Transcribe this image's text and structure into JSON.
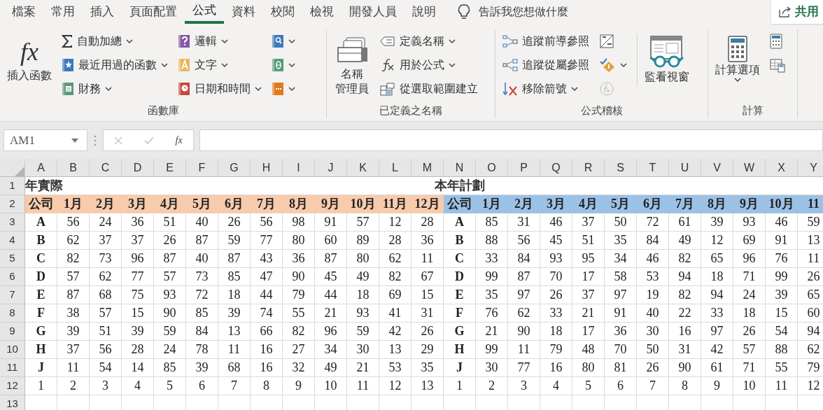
{
  "ribbon_tabs": [
    {
      "label": "檔案",
      "selected": false
    },
    {
      "label": "常用",
      "selected": false
    },
    {
      "label": "插入",
      "selected": false
    },
    {
      "label": "頁面配置",
      "selected": false
    },
    {
      "label": "公式",
      "selected": true
    },
    {
      "label": "資料",
      "selected": false
    },
    {
      "label": "校閱",
      "selected": false
    },
    {
      "label": "檢視",
      "selected": false
    },
    {
      "label": "開發人員",
      "selected": false
    },
    {
      "label": "說明",
      "selected": false
    }
  ],
  "tell_me": "告訴我您想做什麼",
  "share_button": "共用",
  "ribbon_groups": [
    {
      "label": "函數庫",
      "columns": [
        {
          "kind": "large",
          "label": "插入函數",
          "glyph": "fx",
          "dropdown": false
        },
        {
          "kind": "stack",
          "commands": [
            {
              "label": "自動加總",
              "dropdown": true,
              "disabled": false
            },
            {
              "label": "最近用過的函數",
              "dropdown": true,
              "disabled": false
            },
            {
              "label": "財務",
              "dropdown": true,
              "disabled": false
            }
          ]
        },
        {
          "kind": "stack",
          "commands": [
            {
              "label": "邏輯",
              "dropdown": true,
              "disabled": false
            },
            {
              "label": "文字",
              "dropdown": true,
              "disabled": false
            },
            {
              "label": "日期和時間",
              "dropdown": true,
              "disabled": false
            }
          ]
        },
        {
          "kind": "stack",
          "commands": [
            {
              "dropdown": true,
              "disabled": false
            },
            {
              "dropdown": true,
              "disabled": false
            },
            {
              "dropdown": true,
              "disabled": false
            }
          ]
        }
      ]
    },
    {
      "label": "已定義之名稱",
      "columns": [
        {
          "kind": "large",
          "label_lines": [
            "名稱",
            "管理員"
          ],
          "dropdown": false
        },
        {
          "kind": "stack",
          "commands": [
            {
              "label": "定義名稱",
              "dropdown": true,
              "disabled": false
            },
            {
              "label": "用於公式",
              "dropdown": true,
              "disabled": false
            },
            {
              "label": "從選取範圍建立",
              "dropdown": false,
              "disabled": false
            }
          ]
        }
      ]
    },
    {
      "label": "公式稽核",
      "columns": [
        {
          "kind": "stack",
          "commands": [
            {
              "label": "追蹤前導參照",
              "dropdown": false,
              "disabled": false
            },
            {
              "label": "追蹤從屬參照",
              "dropdown": false,
              "disabled": false
            },
            {
              "label": "移除箭號",
              "dropdown": true,
              "disabled": false
            }
          ]
        },
        {
          "kind": "stack",
          "commands": [
            {
              "dropdown": false,
              "disabled": false
            },
            {
              "dropdown": true,
              "disabled": false
            },
            {
              "dropdown": false,
              "disabled": true
            }
          ]
        },
        {
          "kind": "large",
          "label": "監看視窗",
          "dropdown": false
        }
      ]
    },
    {
      "label": "計算",
      "columns": [
        {
          "kind": "large",
          "label": "計算選項",
          "dropdown": true
        },
        {
          "kind": "stack",
          "commands": [
            {
              "dropdown": false,
              "disabled": false
            },
            {
              "dropdown": false,
              "disabled": false
            }
          ]
        }
      ]
    }
  ],
  "formula_bar": {
    "name_box": "AM1",
    "cancel_disabled": true,
    "enter_disabled": true,
    "function_glyph": "fx"
  },
  "sheet": {
    "columns": [
      "A",
      "B",
      "C",
      "D",
      "E",
      "F",
      "G",
      "H",
      "I",
      "J",
      "K",
      "L",
      "M",
      "N",
      "O",
      "P",
      "Q",
      "R",
      "S",
      "T",
      "U",
      "V",
      "W",
      "X",
      "Y"
    ],
    "title_row": {
      "number": "1",
      "titles": [
        "年實際",
        "本年計劃"
      ]
    },
    "header_row": {
      "number": "2",
      "bands": [
        {
          "color": "#f8cbad",
          "cells": [
            "公司",
            "1月",
            "2月",
            "3月",
            "4月",
            "5月",
            "6月",
            "7月",
            "8月",
            "9月",
            "10月",
            "11月",
            "12月"
          ]
        },
        {
          "color": "#9bc2e6",
          "cells": [
            "公司",
            "1月",
            "2月",
            "3月",
            "4月",
            "5月",
            "6月",
            "7月",
            "8月",
            "9月",
            "10月",
            "11"
          ]
        }
      ]
    },
    "rows": [
      {
        "number": "3",
        "kind": "company",
        "cells": [
          "A",
          "56",
          "24",
          "36",
          "51",
          "40",
          "26",
          "56",
          "98",
          "91",
          "57",
          "12",
          "28",
          "A",
          "85",
          "31",
          "46",
          "37",
          "50",
          "72",
          "61",
          "39",
          "93",
          "46",
          "59"
        ]
      },
      {
        "number": "4",
        "kind": "company",
        "cells": [
          "B",
          "62",
          "37",
          "37",
          "26",
          "87",
          "59",
          "77",
          "80",
          "60",
          "89",
          "28",
          "36",
          "B",
          "88",
          "56",
          "45",
          "51",
          "35",
          "84",
          "49",
          "12",
          "69",
          "91",
          "13"
        ]
      },
      {
        "number": "5",
        "kind": "company",
        "cells": [
          "C",
          "82",
          "73",
          "96",
          "87",
          "40",
          "87",
          "43",
          "36",
          "87",
          "80",
          "62",
          "11",
          "C",
          "33",
          "84",
          "93",
          "95",
          "34",
          "46",
          "82",
          "65",
          "96",
          "76",
          "11"
        ]
      },
      {
        "number": "6",
        "kind": "company",
        "cells": [
          "D",
          "57",
          "62",
          "77",
          "57",
          "73",
          "85",
          "47",
          "90",
          "45",
          "49",
          "82",
          "67",
          "D",
          "99",
          "87",
          "70",
          "17",
          "58",
          "53",
          "94",
          "18",
          "71",
          "99",
          "26"
        ]
      },
      {
        "number": "7",
        "kind": "company",
        "cells": [
          "E",
          "87",
          "68",
          "75",
          "93",
          "72",
          "18",
          "44",
          "79",
          "44",
          "18",
          "69",
          "15",
          "E",
          "35",
          "97",
          "26",
          "37",
          "97",
          "19",
          "82",
          "94",
          "24",
          "39",
          "65"
        ]
      },
      {
        "number": "8",
        "kind": "company",
        "cells": [
          "F",
          "38",
          "57",
          "15",
          "90",
          "85",
          "39",
          "74",
          "55",
          "21",
          "93",
          "41",
          "31",
          "F",
          "76",
          "62",
          "33",
          "21",
          "91",
          "40",
          "22",
          "33",
          "18",
          "15",
          "60"
        ]
      },
      {
        "number": "9",
        "kind": "company",
        "cells": [
          "G",
          "39",
          "51",
          "39",
          "59",
          "84",
          "13",
          "66",
          "82",
          "96",
          "59",
          "42",
          "26",
          "G",
          "21",
          "90",
          "18",
          "17",
          "36",
          "30",
          "16",
          "97",
          "26",
          "54",
          "94"
        ]
      },
      {
        "number": "10",
        "kind": "company",
        "cells": [
          "H",
          "37",
          "56",
          "28",
          "24",
          "78",
          "11",
          "16",
          "27",
          "34",
          "30",
          "13",
          "29",
          "H",
          "99",
          "11",
          "79",
          "48",
          "70",
          "50",
          "31",
          "42",
          "57",
          "88",
          "62"
        ]
      },
      {
        "number": "11",
        "kind": "company",
        "cells": [
          "J",
          "11",
          "54",
          "14",
          "85",
          "39",
          "68",
          "16",
          "32",
          "49",
          "21",
          "53",
          "35",
          "J",
          "30",
          "77",
          "16",
          "80",
          "81",
          "26",
          "90",
          "61",
          "71",
          "55",
          "79"
        ]
      },
      {
        "number": "12",
        "kind": "index",
        "cells": [
          "1",
          "2",
          "3",
          "4",
          "5",
          "6",
          "7",
          "8",
          "9",
          "10",
          "11",
          "12",
          "13",
          "1",
          "2",
          "3",
          "4",
          "5",
          "6",
          "7",
          "8",
          "9",
          "10",
          "11",
          "12"
        ]
      },
      {
        "number": "13",
        "kind": "empty"
      }
    ]
  }
}
